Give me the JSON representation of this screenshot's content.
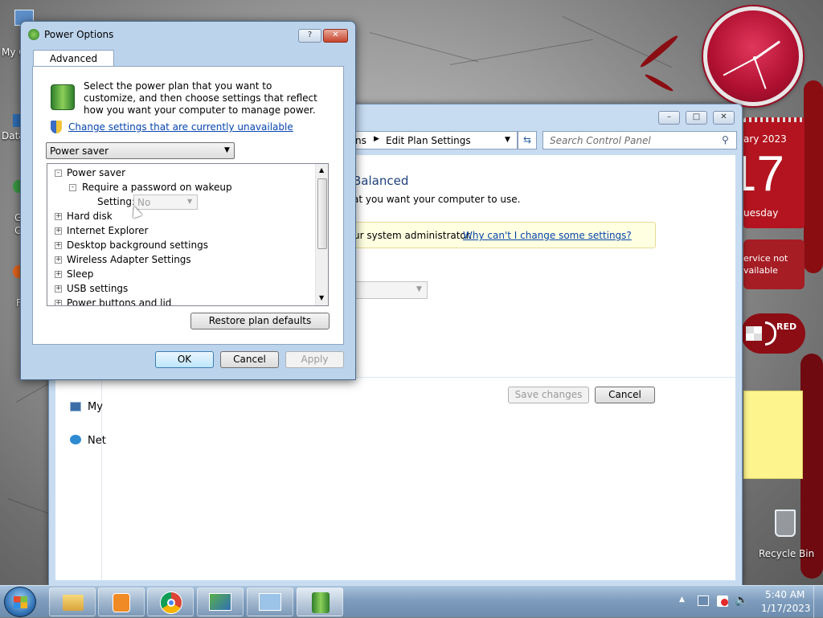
{
  "desktop": {
    "icons_partial": [
      "My C",
      "Data",
      "G",
      "C",
      "F"
    ],
    "recycle_bin": "Recycle Bin"
  },
  "control_panel": {
    "breadcrumb_prefix": "ns",
    "breadcrumb_current": "Edit Plan Settings",
    "search_placeholder": "Search Control Panel",
    "heading": "Balanced",
    "subtext": "at you want your computer to use.",
    "admin_text": "ur system administrator.",
    "admin_link": "Why can't I change some settings?",
    "save_label": "Save changes",
    "cancel_label": "Cancel",
    "nav_items": [
      "My",
      "Net"
    ]
  },
  "gadgets": {
    "calendar_month": "ary 2023",
    "calendar_day": "17",
    "calendar_weekday": "uesday",
    "weather_text_1": "ervice not",
    "weather_text_2": "vailable",
    "red_label": "RED"
  },
  "dialog": {
    "title": "Power Options",
    "help_label": "?",
    "tab_label": "Advanced settings",
    "intro": "Select the power plan that you want to customize, and then choose settings that reflect how you want your computer to manage power.",
    "change_link": "Change settings that are currently unavailable",
    "plan_selected": "Power saver",
    "tree": {
      "root": "Power saver",
      "child": "Require a password on wakeup",
      "setting_label": "Setting:",
      "setting_value": "No",
      "items": [
        "Hard disk",
        "Internet Explorer",
        "Desktop background settings",
        "Wireless Adapter Settings",
        "Sleep",
        "USB settings",
        "Power buttons and lid"
      ]
    },
    "restore_label": "Restore plan defaults",
    "ok_label": "OK",
    "cancel_label": "Cancel",
    "apply_label": "Apply"
  },
  "taskbar": {
    "time": "5:40 AM",
    "date": "1/17/2023"
  }
}
